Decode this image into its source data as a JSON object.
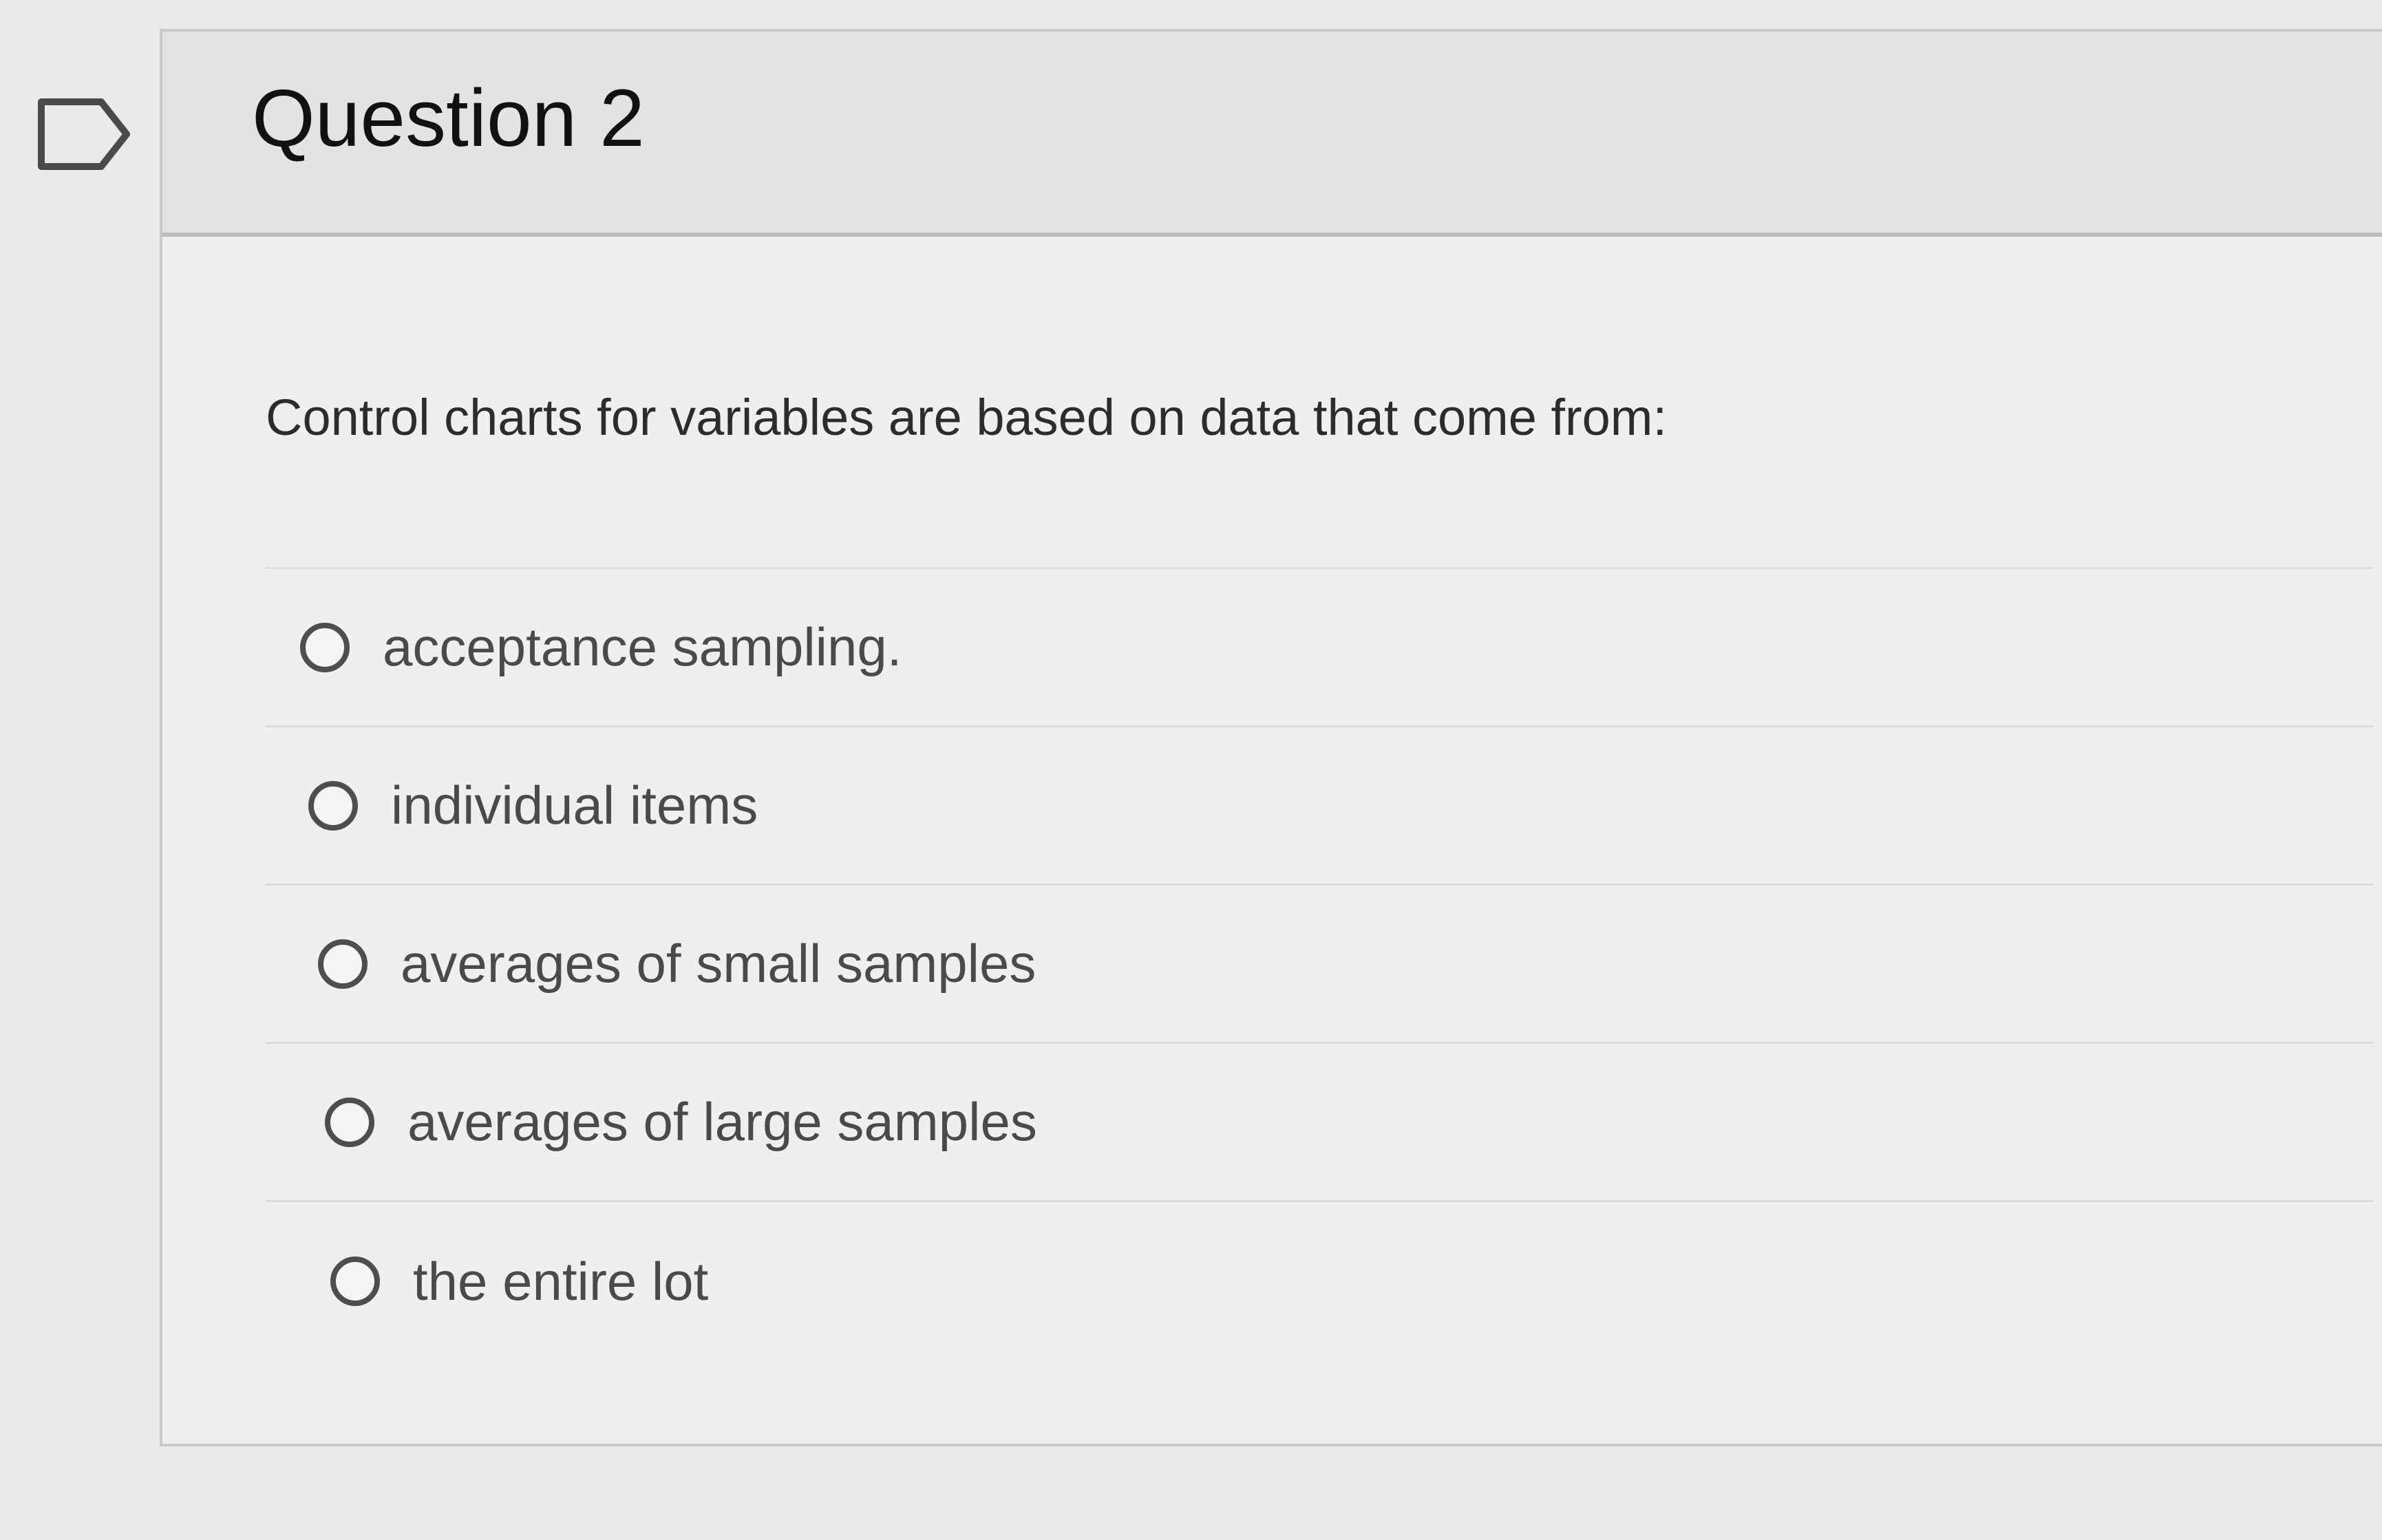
{
  "flag": {
    "icon": "flag-outline-icon"
  },
  "question": {
    "title": "Question 2",
    "prompt": "Control charts for variables are based on data that come from:",
    "answers": [
      {
        "label": "acceptance sampling.",
        "selected": false
      },
      {
        "label": "individual items",
        "selected": false
      },
      {
        "label": "averages of small samples",
        "selected": false
      },
      {
        "label": "averages of large samples",
        "selected": false
      },
      {
        "label": "the entire lot",
        "selected": false
      }
    ]
  }
}
